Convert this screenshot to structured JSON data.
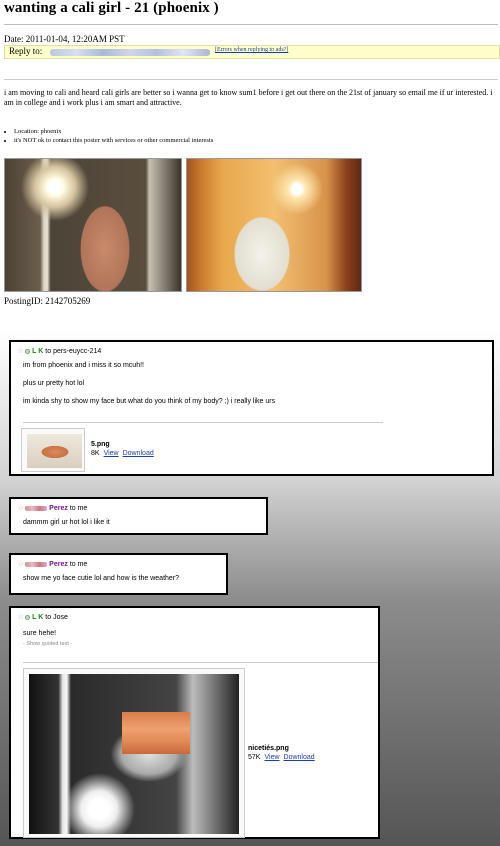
{
  "craigslist": {
    "title": "wanting a cali girl - 21 (phoenix )",
    "date": "Date: 2011-01-04, 12:20AM PST",
    "reply_label": "Reply to:",
    "errors_link": "[Errors when replying to ads?]",
    "body": "i am moving to cali and heard cali girls are better so i wanna get to know sum1 before i get out there on the 21st of january so email me if ur interested. i am in college and i work plus i am smart and attractive.",
    "list": [
      "Location: phoenix",
      "it's NOT ok to contact this poster with services or other commercial interests"
    ],
    "posting_id": "PostingID: 2142705269"
  },
  "emails": [
    {
      "sender": "L K",
      "to": "to pers-euycc-214",
      "lines": [
        "im from phoenix and i miss it so mcuh!!",
        "plus ur pretty hot lol",
        "im kinda shy to show my face but what do you think of my body? ;) i really like urs"
      ],
      "attachment": {
        "filename": "5.png",
        "size": "8K",
        "view": "View",
        "download": "Download"
      }
    },
    {
      "sender": "Perez",
      "to": "to me",
      "lines": [
        "dammm girl ur hot lol i like it"
      ]
    },
    {
      "sender": "Perez",
      "to": "to me",
      "lines": [
        "show me yo face cutie lol and how is the weather?"
      ]
    },
    {
      "sender": "L K",
      "to": "to Jose",
      "lines": [
        "sure hehe!"
      ],
      "quoted": "- Show quoted text -",
      "attachment": {
        "filename": "nicetiés.png",
        "size": "57K",
        "view": "View",
        "download": "Download"
      }
    }
  ],
  "colors": {
    "reply_bar": "#ffffcc",
    "link": "#1a3ea8",
    "sender_green": "#1b7f1b",
    "sender_purple": "#6a1a82"
  }
}
